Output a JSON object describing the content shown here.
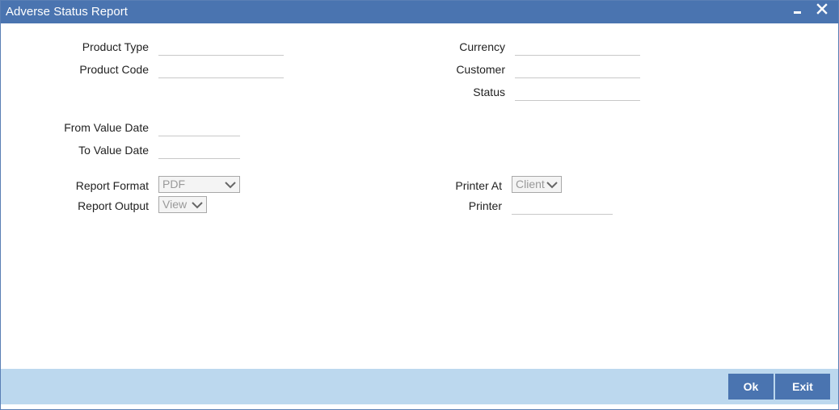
{
  "window": {
    "title": "Adverse Status Report",
    "accent_color": "#4a74b0",
    "footer_color": "#bcd8ee"
  },
  "form": {
    "product_type": {
      "label": "Product Type",
      "value": ""
    },
    "product_code": {
      "label": "Product Code",
      "value": ""
    },
    "currency": {
      "label": "Currency",
      "value": ""
    },
    "customer": {
      "label": "Customer",
      "value": ""
    },
    "status": {
      "label": "Status",
      "value": ""
    },
    "from_value_date": {
      "label": "From Value Date",
      "value": ""
    },
    "to_value_date": {
      "label": "To Value Date",
      "value": ""
    },
    "report_format": {
      "label": "Report Format",
      "value": "PDF"
    },
    "report_output": {
      "label": "Report Output",
      "value": "View"
    },
    "printer_at": {
      "label": "Printer At",
      "value": "Client"
    },
    "printer": {
      "label": "Printer",
      "value": ""
    }
  },
  "footer": {
    "ok_label": "Ok",
    "exit_label": "Exit"
  }
}
